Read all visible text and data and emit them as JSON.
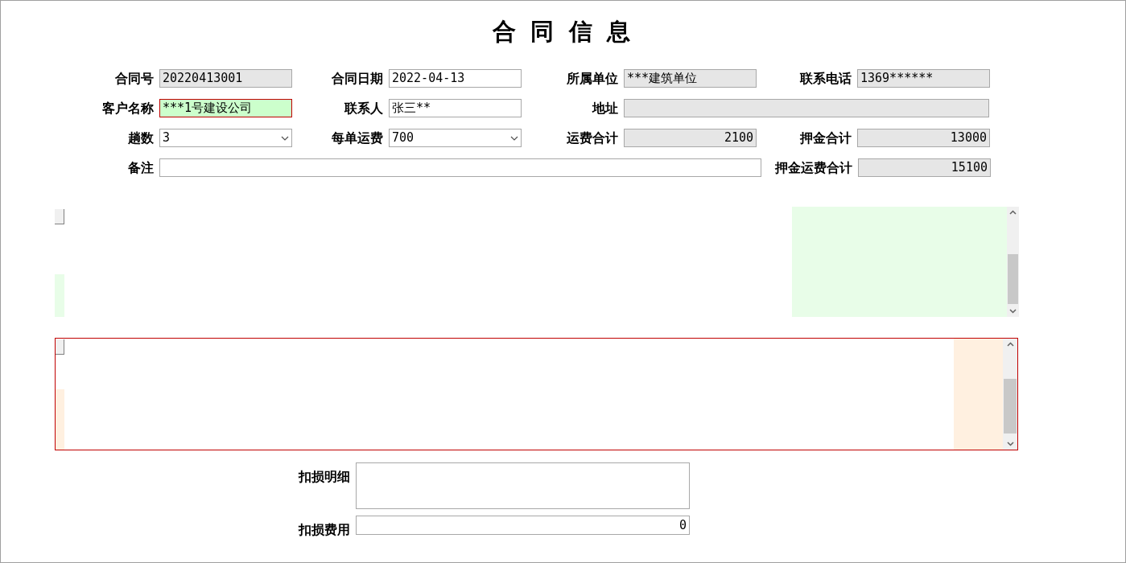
{
  "title": "合 同 信 息",
  "rows": [
    [
      {
        "label": "合同号",
        "value": "20220413001",
        "kind": "text",
        "readonly": true,
        "highlighted": false
      },
      {
        "label": "合同日期",
        "value": "2022-04-13",
        "kind": "text",
        "readonly": false,
        "highlighted": false
      },
      {
        "label": "所属单位",
        "value": "***建筑单位",
        "kind": "text",
        "readonly": true,
        "highlighted": false
      },
      {
        "label": "联系电话",
        "value": "1369******",
        "kind": "text",
        "readonly": true,
        "highlighted": false
      }
    ],
    [
      {
        "label": "客户名称",
        "value": "***1号建设公司",
        "kind": "text",
        "readonly": false,
        "highlighted": true
      },
      {
        "label": "联系人",
        "value": "张三**",
        "kind": "text",
        "readonly": false,
        "highlighted": false
      },
      {
        "label": "地址",
        "kind": "wide",
        "readonly": true,
        "highlighted": false
      }
    ],
    [
      {
        "label": "趟数",
        "value": "3",
        "kind": "select",
        "readonly": false,
        "highlighted": false
      },
      {
        "label": "每单运费",
        "value": "700",
        "kind": "select",
        "readonly": false,
        "highlighted": false
      },
      {
        "label": "运费合计",
        "value": "2100",
        "kind": "text",
        "numeric": true,
        "readonly": true,
        "highlighted": false
      },
      {
        "label": "押金合计",
        "value": "13000",
        "kind": "text",
        "numeric": true,
        "readonly": true,
        "highlighted": false
      }
    ],
    [
      {
        "label": "备注",
        "kind": "wide",
        "readonly": false,
        "highlighted": false
      },
      {
        "label": "押金运费合计",
        "value": "15100",
        "kind": "text",
        "numeric": true,
        "readonly": true,
        "highlighted": false
      }
    ]
  ],
  "damage": [
    {
      "label": "扣损明细",
      "kind": "textarea"
    },
    {
      "label": "扣损费用",
      "value": "0",
      "kind": "text",
      "numeric": true
    }
  ]
}
